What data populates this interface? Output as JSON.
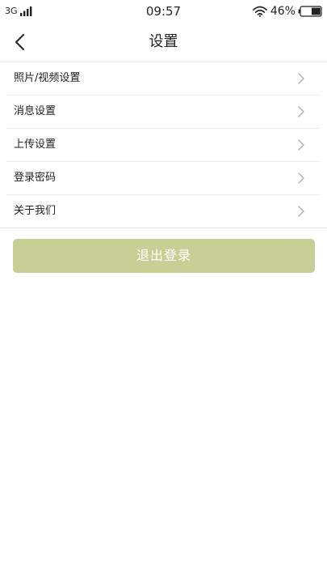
{
  "status_bar": {
    "network": "3G",
    "time": "09:57",
    "battery": "46%",
    "battery_level": 0.46
  },
  "header": {
    "title": "设置",
    "back_icon": "chevron-left-icon"
  },
  "settings": {
    "items": [
      {
        "label": "照片/视频设置"
      },
      {
        "label": "消息设置"
      },
      {
        "label": "上传设置"
      },
      {
        "label": "登录密码"
      },
      {
        "label": "关于我们"
      }
    ]
  },
  "logout": {
    "label": "退出登录",
    "color": "#c7cf94"
  },
  "colors": {
    "divider": "#ececec",
    "chevron": "#aaaaaa",
    "text": "#222222"
  }
}
